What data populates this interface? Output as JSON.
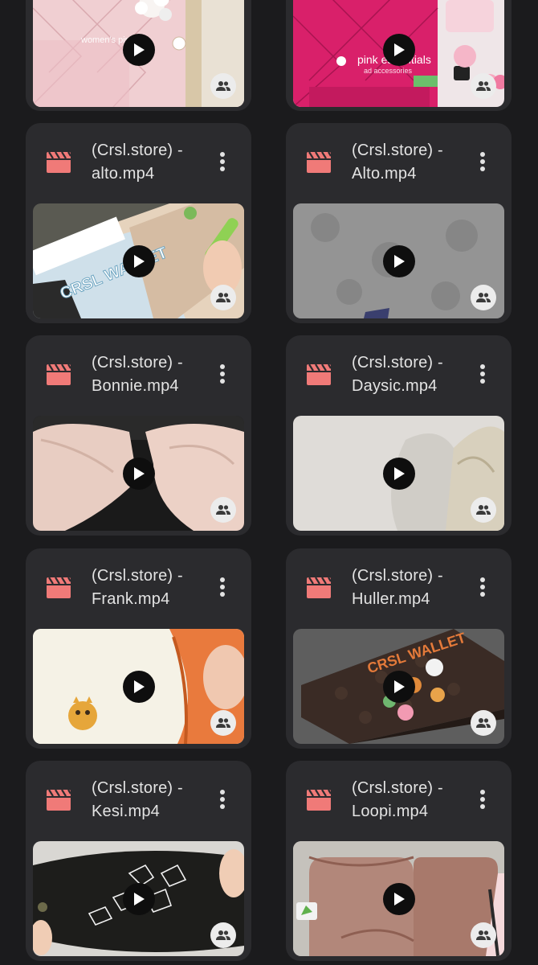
{
  "colors": {
    "background": "#1b1b1d",
    "card": "#2b2b2e",
    "file_icon": "#f07a78",
    "title_text": "#e3e3e3"
  },
  "icons": {
    "file_icon": "video-clapper-icon",
    "more": "more-vert-icon",
    "play": "play-icon",
    "shared": "shared-people-icon"
  },
  "partial_row": [
    {
      "thumb_overlay": "women's pink · · ·"
    },
    {
      "thumb_overlay": "pink essentials",
      "thumb_overlay_sub": "ad accessories"
    }
  ],
  "files": [
    {
      "line1": "(Crsl.store) -",
      "line2": "alto.mp4"
    },
    {
      "line1": "(Crsl.store) -",
      "line2": "Alto.mp4"
    },
    {
      "line1": "(Crsl.store) -",
      "line2": "Bonnie.mp4"
    },
    {
      "line1": "(Crsl.store) -",
      "line2": "Daysic.mp4"
    },
    {
      "line1": "(Crsl.store) -",
      "line2": "Frank.mp4"
    },
    {
      "line1": "(Crsl.store) -",
      "line2": "Huller.mp4"
    },
    {
      "line1": "(Crsl.store) -",
      "line2": "Kesi.mp4"
    },
    {
      "line1": "(Crsl.store) -",
      "line2": "Loopi.mp4"
    }
  ],
  "thumb_text": {
    "alto": "CRSL WALLET",
    "huller": "CRSL WALLET"
  }
}
